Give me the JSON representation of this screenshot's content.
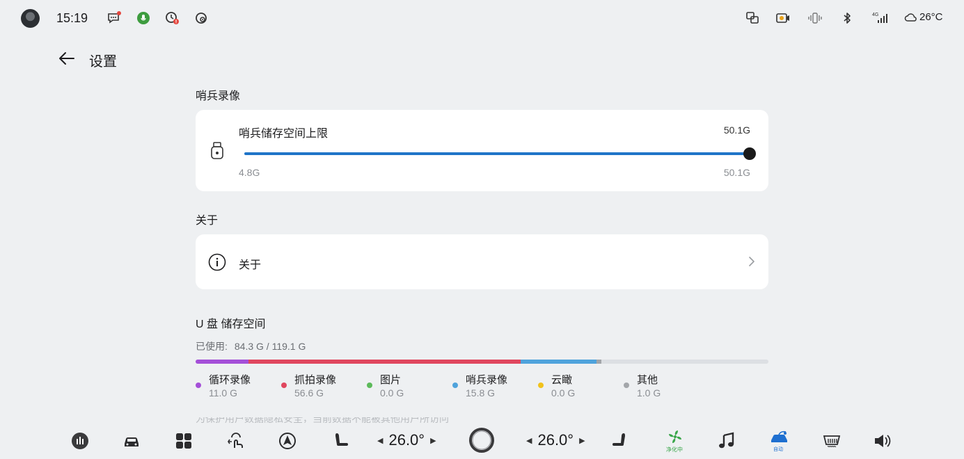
{
  "status_bar": {
    "time": "15:19",
    "weather": {
      "temp": "26°C",
      "icon": "cloud-icon"
    },
    "left_icons": [
      "message-notification-icon",
      "voice-assistant-icon",
      "map-alert-icon",
      "location-target-icon"
    ],
    "right_icons": [
      "screen-mirror-icon",
      "dashcam-icon",
      "vibrate-icon",
      "bluetooth-icon",
      "signal-4g-icon"
    ],
    "signal_label": "4G"
  },
  "header": {
    "title": "设置"
  },
  "sentry": {
    "section_title": "哨兵录像",
    "slider": {
      "label": "哨兵储存空间上限",
      "value": "50.1G",
      "min": "4.8G",
      "max": "50.1G",
      "value_fraction": 1.0
    }
  },
  "about": {
    "section_title": "关于",
    "label": "关于"
  },
  "usb": {
    "section_title": "U 盘 储存空间",
    "used_label": "已使用:",
    "used_value": "84.3 G / 119.1 G",
    "segments": [
      {
        "name": "循环录像",
        "size": "11.0 G",
        "gb": 11.0,
        "color": "#a44fd8"
      },
      {
        "name": "抓拍录像",
        "size": "56.6 G",
        "gb": 56.6,
        "color": "#e0475f"
      },
      {
        "name": "图片",
        "size": "0.0 G",
        "gb": 0.0,
        "color": "#5cba5a"
      },
      {
        "name": "哨兵录像",
        "size": "15.8 G",
        "gb": 15.8,
        "color": "#4fa3dc"
      },
      {
        "name": "云瞰",
        "size": "0.0 G",
        "gb": 0.0,
        "color": "#f1c21b"
      },
      {
        "name": "其他",
        "size": "1.0 G",
        "gb": 1.0,
        "color": "#a3a6aa"
      }
    ],
    "total_gb": 119.1,
    "notice": "为保护用户数据隐私安全，当前数据不能被其他用户所访问"
  },
  "dock": {
    "driver_temp": "26.0°",
    "passenger_temp": "26.0°",
    "purify_label": "净化中",
    "auto_label": "自动"
  }
}
